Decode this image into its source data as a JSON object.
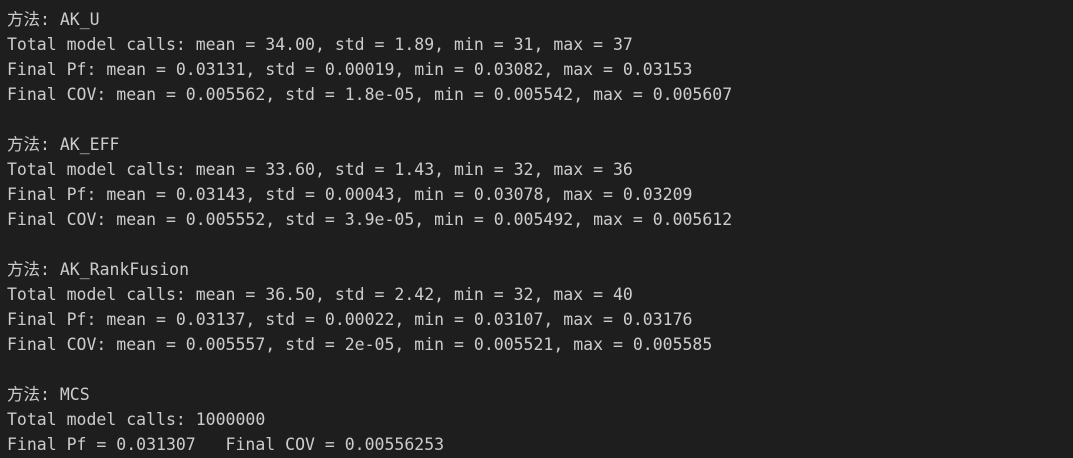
{
  "terminal": {
    "lines": [
      "方法: AK_U",
      "Total model calls: mean = 34.00, std = 1.89, min = 31, max = 37",
      "Final Pf: mean = 0.03131, std = 0.00019, min = 0.03082, max = 0.03153",
      "Final COV: mean = 0.005562, std = 1.8e-05, min = 0.005542, max = 0.005607",
      "",
      "方法: AK_EFF",
      "Total model calls: mean = 33.60, std = 1.43, min = 32, max = 36",
      "Final Pf: mean = 0.03143, std = 0.00043, min = 0.03078, max = 0.03209",
      "Final COV: mean = 0.005552, std = 3.9e-05, min = 0.005492, max = 0.005612",
      "",
      "方法: AK_RankFusion",
      "Total model calls: mean = 36.50, std = 2.42, min = 32, max = 40",
      "Final Pf: mean = 0.03137, std = 0.00022, min = 0.03107, max = 0.03176",
      "Final COV: mean = 0.005557, std = 2e-05, min = 0.005521, max = 0.005585",
      "",
      "方法: MCS",
      "Total model calls: 1000000",
      "Final Pf = 0.031307   Final COV = 0.00556253"
    ],
    "colors": {
      "background": "#1e1e1e",
      "text": "#cccccc"
    }
  }
}
